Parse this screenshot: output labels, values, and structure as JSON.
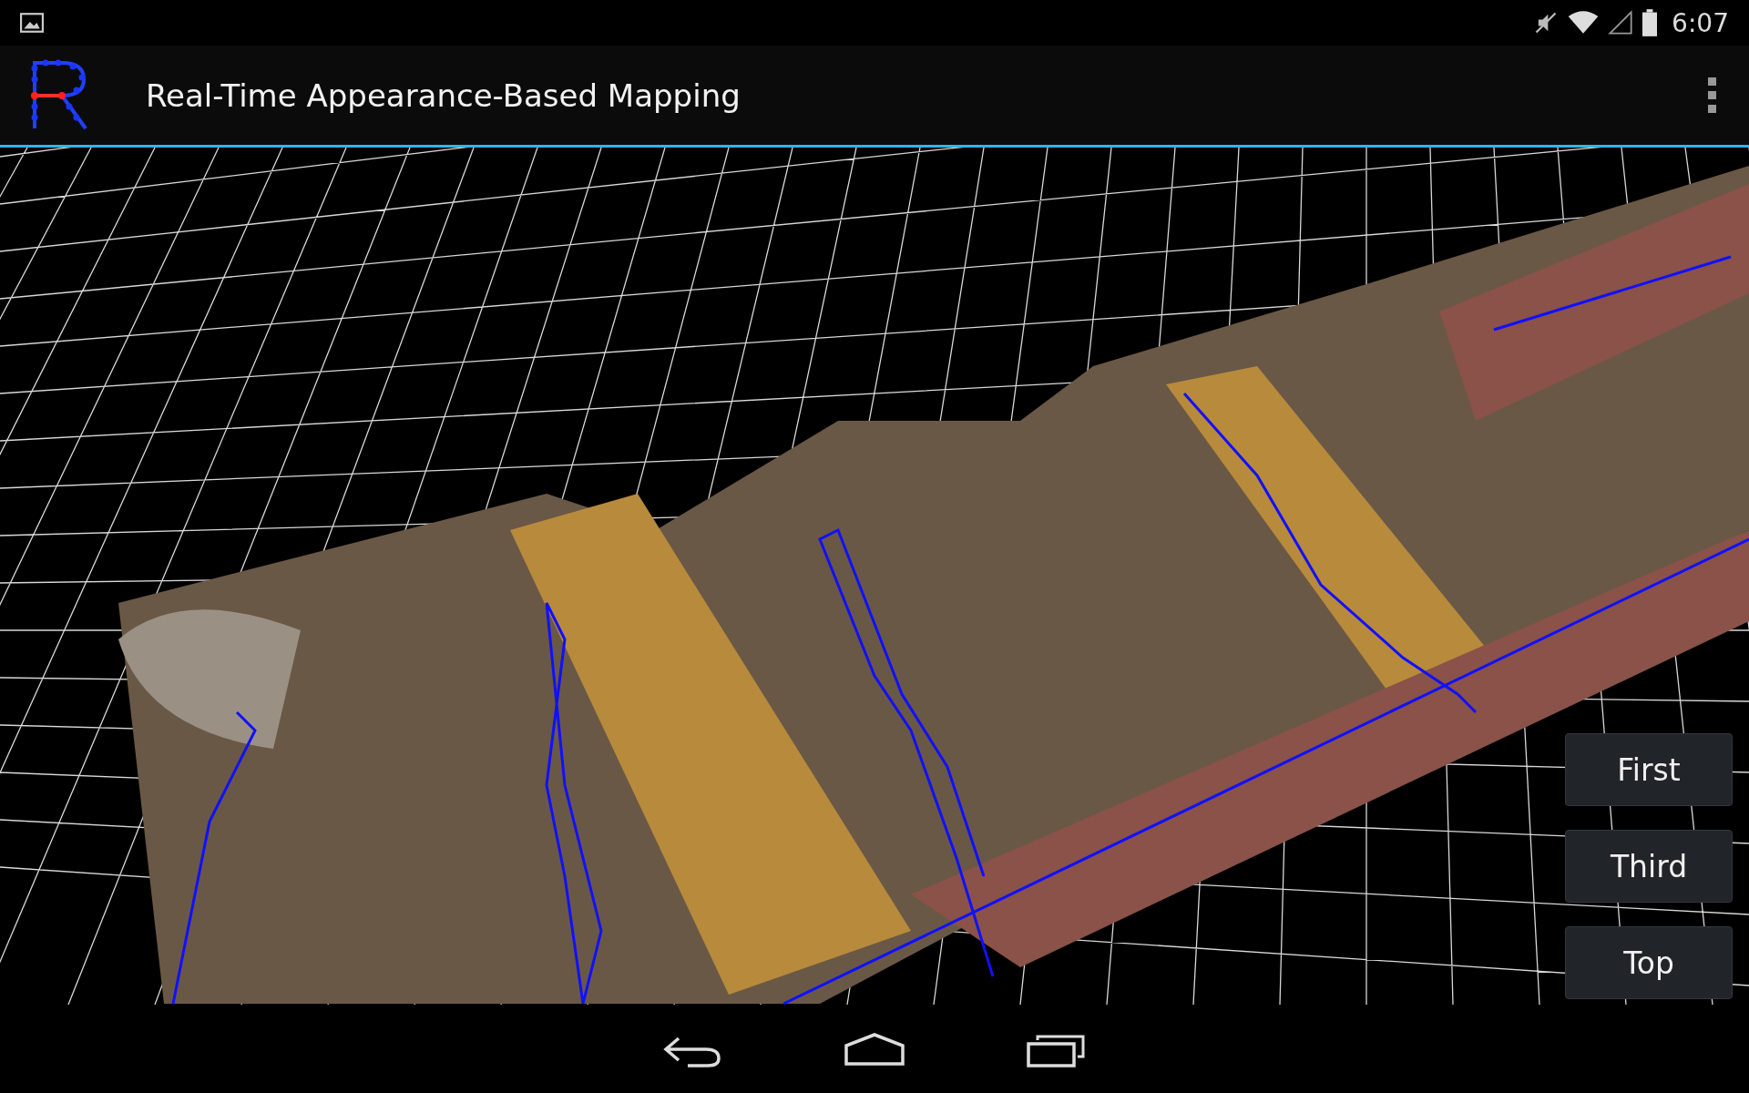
{
  "status_bar": {
    "time": "6:07"
  },
  "app_bar": {
    "title": "Real-Time Appearance-Based Mapping"
  },
  "view_buttons": [
    {
      "label": "First"
    },
    {
      "label": "Third"
    },
    {
      "label": "Top"
    }
  ]
}
